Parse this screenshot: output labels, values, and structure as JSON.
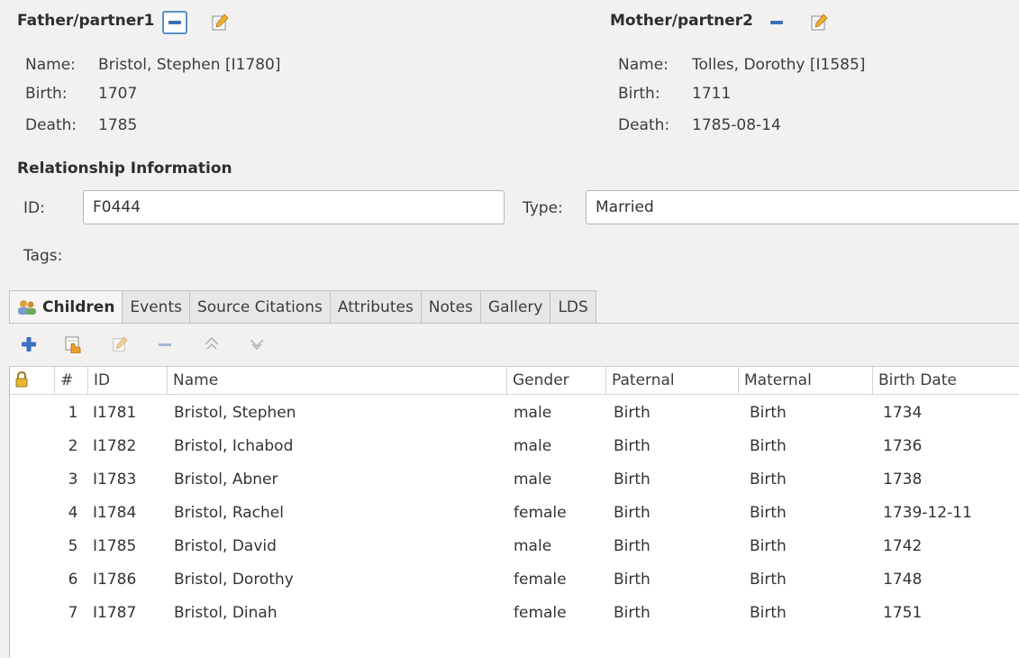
{
  "father": {
    "header": "Father/partner1",
    "name_label": "Name:",
    "name": "Bristol, Stephen [I1780]",
    "birth_label": "Birth:",
    "birth": "1707",
    "death_label": "Death:",
    "death": "1785"
  },
  "mother": {
    "header": "Mother/partner2",
    "name_label": "Name:",
    "name": "Tolles, Dorothy [I1585]",
    "birth_label": "Birth:",
    "birth": "1711",
    "death_label": "Death:",
    "death": "1785-08-14"
  },
  "relationship": {
    "header": "Relationship Information",
    "id_label": "ID:",
    "id_value": "F0444",
    "type_label": "Type:",
    "type_value": "Married",
    "tags_label": "Tags:"
  },
  "tabs": [
    "Children",
    "Events",
    "Source Citations",
    "Attributes",
    "Notes",
    "Gallery",
    "LDS"
  ],
  "toolbar_icons": [
    "add-icon",
    "share-existing-icon",
    "edit-icon",
    "remove-icon",
    "move-up-icon",
    "move-down-icon"
  ],
  "table": {
    "columns": [
      "#",
      "ID",
      "Name",
      "Gender",
      "Paternal",
      "Maternal",
      "Birth Date"
    ],
    "rows": [
      [
        "1",
        "I1781",
        "Bristol, Stephen",
        "male",
        "Birth",
        "Birth",
        "1734"
      ],
      [
        "2",
        "I1782",
        "Bristol, Ichabod",
        "male",
        "Birth",
        "Birth",
        "1736"
      ],
      [
        "3",
        "I1783",
        "Bristol, Abner",
        "male",
        "Birth",
        "Birth",
        "1738"
      ],
      [
        "4",
        "I1784",
        "Bristol, Rachel",
        "female",
        "Birth",
        "Birth",
        "1739-12-11"
      ],
      [
        "5",
        "I1785",
        "Bristol, David",
        "male",
        "Birth",
        "Birth",
        "1742"
      ],
      [
        "6",
        "I1786",
        "Bristol, Dorothy",
        "female",
        "Birth",
        "Birth",
        "1748"
      ],
      [
        "7",
        "I1787",
        "Bristol, Dinah",
        "female",
        "Birth",
        "Birth",
        "1751"
      ]
    ]
  }
}
